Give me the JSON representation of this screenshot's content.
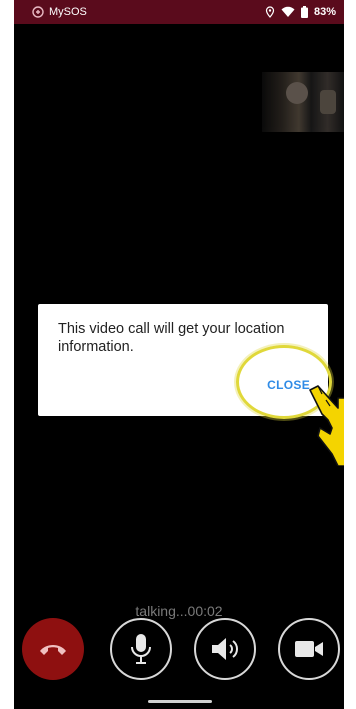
{
  "status_bar": {
    "app_name": "MySOS",
    "battery": "83%",
    "color": "#5a0b1c"
  },
  "dialog": {
    "message": "This video call will get your location information.",
    "close_label": "CLOSE",
    "close_color": "#2f8be6",
    "highlight_color": "#e0d83a"
  },
  "call": {
    "status": "talking...00:02"
  },
  "controls": {
    "items": [
      {
        "icon": "hang-up-icon",
        "color": "#8e1010"
      },
      {
        "icon": "microphone-icon"
      },
      {
        "icon": "speaker-icon"
      },
      {
        "icon": "video-camera-icon"
      }
    ]
  }
}
